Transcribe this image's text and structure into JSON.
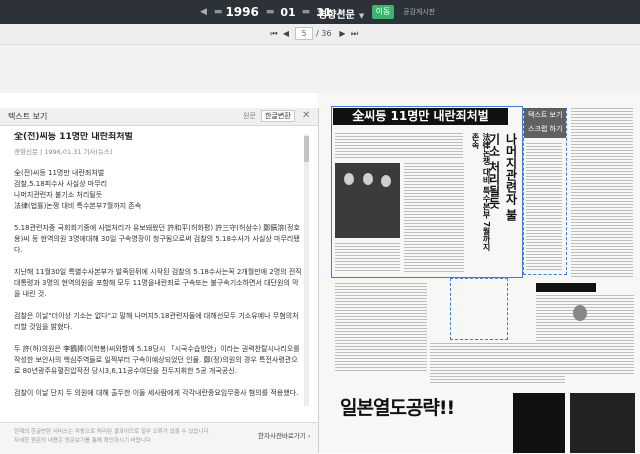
{
  "topbar": {
    "year": "1996",
    "month": "01",
    "day": "31",
    "newspaper": "경향신문",
    "go_label": "이동",
    "notice_label": "공감게시판"
  },
  "pager": {
    "current": "5",
    "total": "/ 36"
  },
  "text_pane": {
    "title": "텍스트 보기",
    "tab_original": "원문",
    "tab_convert": "한글변환",
    "article": {
      "headline": "全(전)씨등 11명만 내란죄처벌",
      "meta": "경향신문 | 1996.01.31 기사(뉴스)",
      "paragraphs": [
        "全(전)씨등 11명만 내란죄처벌\n검찰,5.18피수사 사실상 마무리\n나머지관련자 불기소 처리될듯\n法律(법률)논쟁 대비 특수본부7월까지 존속",
        "5.18관련자중 국회회기중에 사법처리가 유보돼왔던 許和平(허화평) 許三守(허삼수) 鄭鎬溶(정호용)씨 등 현역의원 3명에대해 30일 구속영장이 청구됨으로써 검찰의 5.18수사가 사실상 마무리됐다.",
        "지난해 11월30일 특별수사본부가 발족된뒤에 시작된 검찰의 5.18수사는꼭 2개월만에 2명의 전직대통령과 3명의 현역의원을 포함해 모두 11명을내란죄로 구속또는 불구속기소하면서 대단원의 막을 내린 것.",
        "검찰은 이날\"더이상 기소는 없다\"고 말해 나머지5.18관련자들에 대해선모두 기소유예나 무혐의처리할 것임을 밝혔다.",
        "두 許(허)의원은 李鶴捧(이학봉)씨와함께 5.18당시 「시국수습방안」이라는 권력찬탈시나리오를 작성한 보안사의 핵심주역들로 일찍부터 구속이예상되었던 인물. 鄭(정)의원의 경우 특전사령관으로 80년광주유혈진압작전 당시3,6,11공수여단을 진두지휘한 5공 개국공신.",
        "검찰이 이날 단지 두 의원에 대해 출두한 이들 세사람에게 각각내란중요임무종사 혐의를 적용했다."
      ]
    },
    "footer": {
      "note1": "현재의 한글변환 서비스는 자동으로 처리된 결과이므로 일부 오류가 있을 수 있습니다.",
      "note2": "자세한 원문의 내용은 원문보기를 통해 확인하시기 바랍니다.",
      "link": "한자사전바로가기 ›"
    }
  },
  "newspaper": {
    "headline": "全씨등 11명만 내란죄처벌",
    "sub1": "나머지관련자 불기소 처리될듯",
    "sub2": "法律논쟁 대비 특수본부 7월까지 존속",
    "tooltip": [
      "텍스트 보기",
      "스크랩 하기"
    ],
    "ad_text": "일본열도공략!!"
  }
}
